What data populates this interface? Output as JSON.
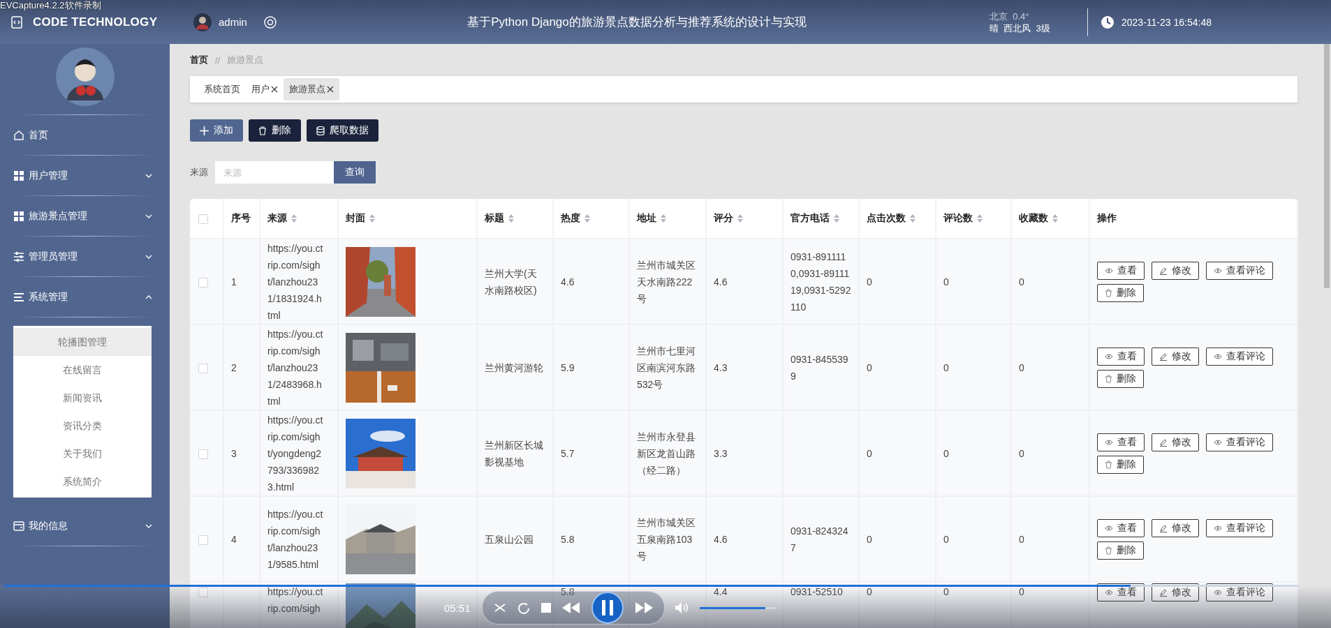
{
  "recorder": {
    "caption": "EVCapture4.2.2软件录制"
  },
  "header": {
    "logo": "CODE TECHNOLOGY",
    "user": "admin",
    "title": "基于Python Django的旅游景点数据分析与推荐系统的设计与实现",
    "weather": {
      "city": "北京",
      "temp": "0.4°",
      "sky": "晴",
      "wind": "西北风",
      "grade": "3级"
    },
    "datetime": "2023-11-23 16:54:48"
  },
  "sidebar": {
    "items": [
      {
        "label": "首页",
        "kind": "link"
      },
      {
        "label": "用户管理",
        "kind": "group",
        "expanded": false
      },
      {
        "label": "旅游景点管理",
        "kind": "group",
        "expanded": false
      },
      {
        "label": "管理员管理",
        "kind": "group",
        "expanded": false
      },
      {
        "label": "系统管理",
        "kind": "group",
        "expanded": true,
        "children": [
          {
            "label": "轮播图管理",
            "hovered": true
          },
          {
            "label": "在线留言",
            "hovered": false
          },
          {
            "label": "新闻资讯",
            "hovered": false
          },
          {
            "label": "资讯分类",
            "hovered": false
          },
          {
            "label": "关于我们",
            "hovered": false
          },
          {
            "label": "系统简介",
            "hovered": false
          }
        ]
      },
      {
        "label": "我的信息",
        "kind": "group",
        "expanded": false
      }
    ]
  },
  "breadcrumb": {
    "items": [
      "首页",
      "旅游景点"
    ],
    "separator": "//"
  },
  "tabs": [
    {
      "label": "系统首页",
      "closable": false,
      "selected": false
    },
    {
      "label": "用户",
      "closable": true,
      "selected": false
    },
    {
      "label": "旅游景点",
      "closable": true,
      "selected": true
    }
  ],
  "toolbar": [
    {
      "label": "添加",
      "kind": "primary"
    },
    {
      "label": "删除",
      "kind": "dark"
    },
    {
      "label": "爬取数据",
      "kind": "dark"
    }
  ],
  "search": {
    "label": "来源",
    "placeholder": "来源",
    "button": "查询"
  },
  "table": {
    "columns": [
      {
        "kind": "checkbox",
        "checked": false
      },
      {
        "label": "序号",
        "sortable": false
      },
      {
        "label": "来源",
        "sortable": true
      },
      {
        "label": "封面",
        "sortable": true
      },
      {
        "label": "标题",
        "sortable": true
      },
      {
        "label": "热度",
        "sortable": true
      },
      {
        "label": "地址",
        "sortable": true
      },
      {
        "label": "评分",
        "sortable": true
      },
      {
        "label": "官方电话",
        "sortable": true
      },
      {
        "label": "点击次数",
        "sortable": true
      },
      {
        "label": "评论数",
        "sortable": true
      },
      {
        "label": "收藏数",
        "sortable": true
      },
      {
        "label": "操作",
        "sortable": false
      }
    ],
    "rows": [
      {
        "checked": false,
        "index": "1",
        "source": "https://you.ctrip.com/sight/lanzhou231/1831924.html",
        "cover": {
          "kind": "picture"
        },
        "title": "兰州大学(天水南路校区)",
        "heat": "4.6",
        "address": "兰州市城关区天水南路222号",
        "score": "4.6",
        "phone": "0931-8911110,0931-8911119,0931-5292110",
        "clicks": "0",
        "comments": "0",
        "favorites": "0",
        "actions": [
          "查看",
          "修改",
          "查看评论",
          "删除"
        ]
      },
      {
        "checked": false,
        "index": "2",
        "source": "https://you.ctrip.com/sight/lanzhou231/2483968.html",
        "cover": {
          "kind": "picture"
        },
        "title": "兰州黄河游轮",
        "heat": "5.9",
        "address": "兰州市七里河区南滨河东路532号",
        "score": "4.3",
        "phone": "0931-8455399",
        "clicks": "0",
        "comments": "0",
        "favorites": "0",
        "actions": [
          "查看",
          "修改",
          "查看评论",
          "删除"
        ]
      },
      {
        "checked": false,
        "index": "3",
        "source": "https://you.ctrip.com/sight/yongdeng2793/3369823.html",
        "cover": {
          "kind": "picture"
        },
        "title": "兰州新区长城影视基地",
        "heat": "5.7",
        "address": "兰州市永登县新区龙首山路（经二路）",
        "score": "3.3",
        "clicks": "0",
        "comments": "0",
        "favorites": "0",
        "actions": [
          "查看",
          "修改",
          "查看评论",
          "删除"
        ]
      },
      {
        "checked": false,
        "index": "4",
        "source": "https://you.ctrip.com/sight/lanzhou231/9585.html",
        "cover": {
          "kind": "picture"
        },
        "title": "五泉山公园",
        "heat": "5.8",
        "address": "兰州市城关区五泉南路103号",
        "score": "4.6",
        "phone": "0931-8243247",
        "clicks": "0",
        "comments": "0",
        "favorites": "0",
        "actions": [
          "查看",
          "修改",
          "查看评论",
          "删除"
        ]
      },
      {
        "checked": false,
        "source": "https://you.ctrip.com/sigh",
        "cover": {
          "kind": "picture"
        },
        "heat": "5.8",
        "score": "4.4",
        "phone": "0931-52510",
        "clicks": "0",
        "comments": "0",
        "favorites": "0",
        "actions": [
          "查看",
          "修改",
          "查看评论"
        ]
      }
    ]
  },
  "player": {
    "time": "05:51",
    "progress": {
      "level": 0.87
    },
    "volume": {
      "level": 0.85
    },
    "playing": true
  }
}
